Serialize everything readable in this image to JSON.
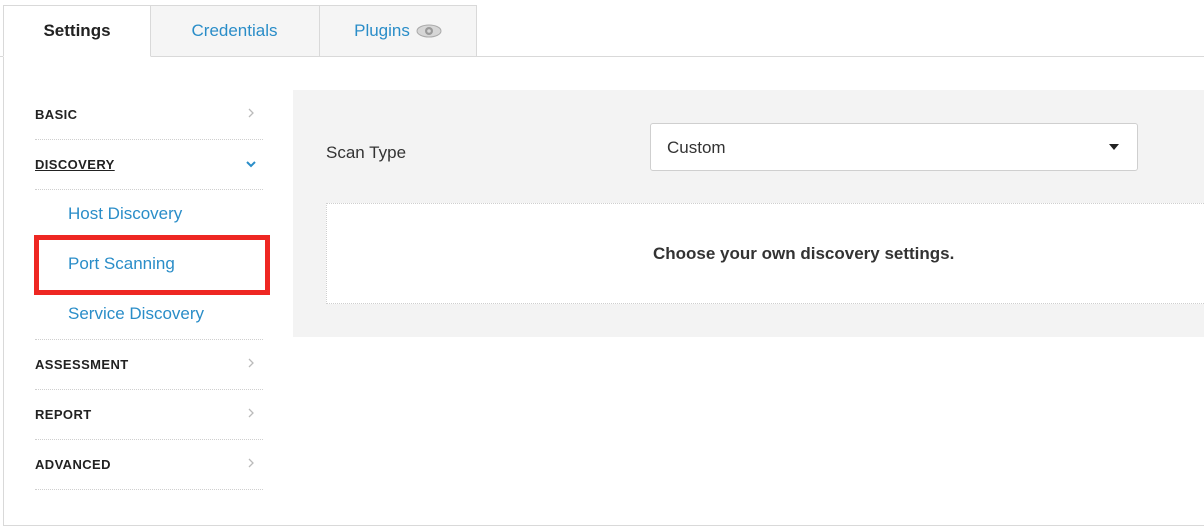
{
  "tabs": {
    "settings": "Settings",
    "credentials": "Credentials",
    "plugins": "Plugins",
    "plugins_icon": "eye-icon"
  },
  "sidebar": {
    "sections": {
      "basic": "BASIC",
      "discovery": "DISCOVERY",
      "assessment": "ASSESSMENT",
      "report": "REPORT",
      "advanced": "ADVANCED"
    },
    "discovery_items": {
      "host": "Host Discovery",
      "port": "Port Scanning",
      "service": "Service Discovery"
    },
    "expanded_section": "DISCOVERY",
    "highlighted_item": "Port Scanning"
  },
  "main": {
    "scan_type_label": "Scan Type",
    "scan_type_value": "Custom",
    "description": "Choose your own discovery settings."
  },
  "colors": {
    "link": "#2a8dc8",
    "highlight": "#ee2722",
    "panel_bg": "#f3f3f3",
    "chevron_expanded": "#2a8dc8"
  }
}
